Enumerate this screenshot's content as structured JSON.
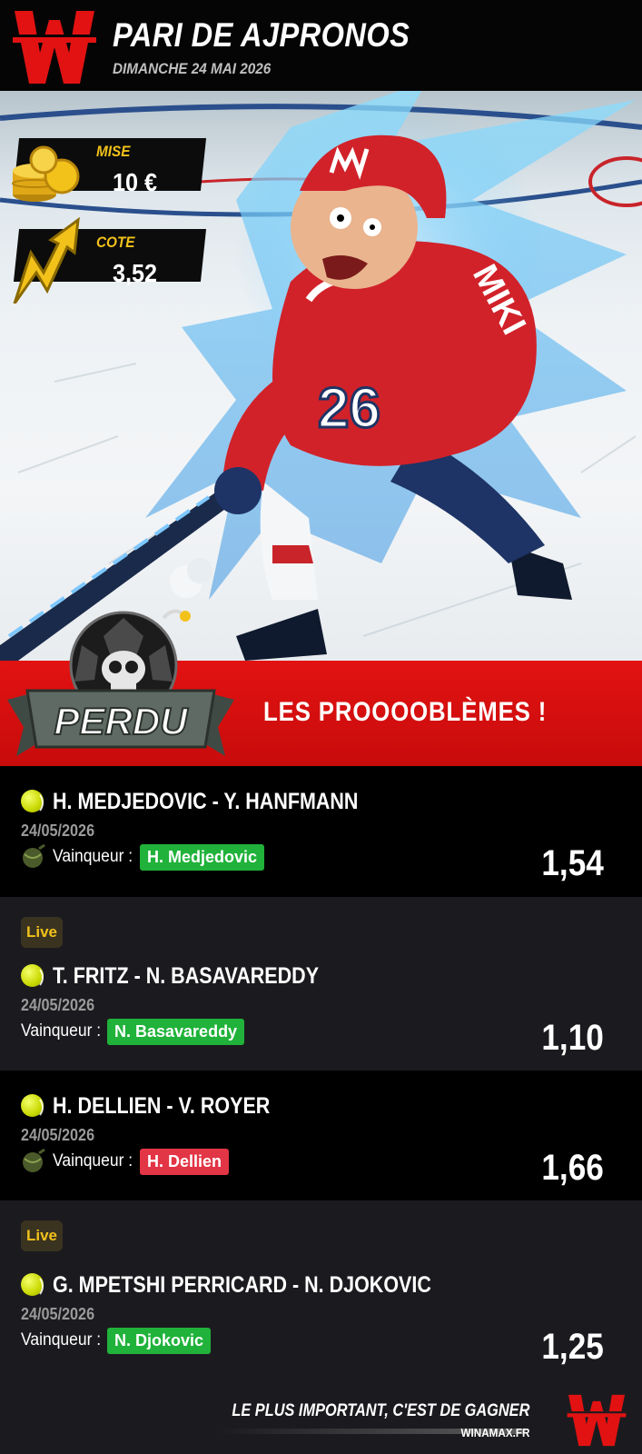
{
  "header": {
    "title": "PARI DE AJPRONOS",
    "subtitle": "DIMANCHE 24 MAI 2026"
  },
  "stake": {
    "label": "MISE",
    "value": "10 €",
    "icon": "coins-icon"
  },
  "odds": {
    "label": "COTE",
    "value": "3,52",
    "icon": "lightning-arrow-icon"
  },
  "hero": {
    "helmet_logo": "W",
    "jersey_number": "26",
    "jersey_text": "MIKI"
  },
  "result": {
    "badge": "PERDU",
    "message": "LES PROOOOBLÈMES !",
    "icon": "skull-ball-bomb-icon"
  },
  "bets": [
    {
      "live": "",
      "match": "H. MEDJEDOVIC - Y. HANFMANN",
      "date": "24/05/2026",
      "label": "Vainqueur :",
      "pick": "H. Medjedovic",
      "status": "won",
      "odd": "1,54"
    },
    {
      "live": "Live",
      "match": "T. FRITZ - N. BASAVAREDDY",
      "date": "24/05/2026",
      "label": "Vainqueur :",
      "pick": "N. Basavareddy",
      "status": "won",
      "odd": "1,10"
    },
    {
      "live": "",
      "match": "H. DELLIEN - V. ROYER",
      "date": "24/05/2026",
      "label": "Vainqueur :",
      "pick": "H. Dellien",
      "status": "lost",
      "odd": "1,66"
    },
    {
      "live": "Live",
      "match": "G. MPETSHI PERRICARD - N. DJOKOVIC",
      "date": "24/05/2026",
      "label": "Vainqueur :",
      "pick": "N. Djokovic",
      "status": "won",
      "odd": "1,25"
    }
  ],
  "footer": {
    "tagline": "LE PLUS IMPORTANT, C'EST DE GAGNER",
    "site": "WINAMAX.FR"
  },
  "colors": {
    "brand_red": "#e21212",
    "gold": "#f2c21b",
    "won_green": "#20b23a",
    "lost_red": "#e23545"
  }
}
